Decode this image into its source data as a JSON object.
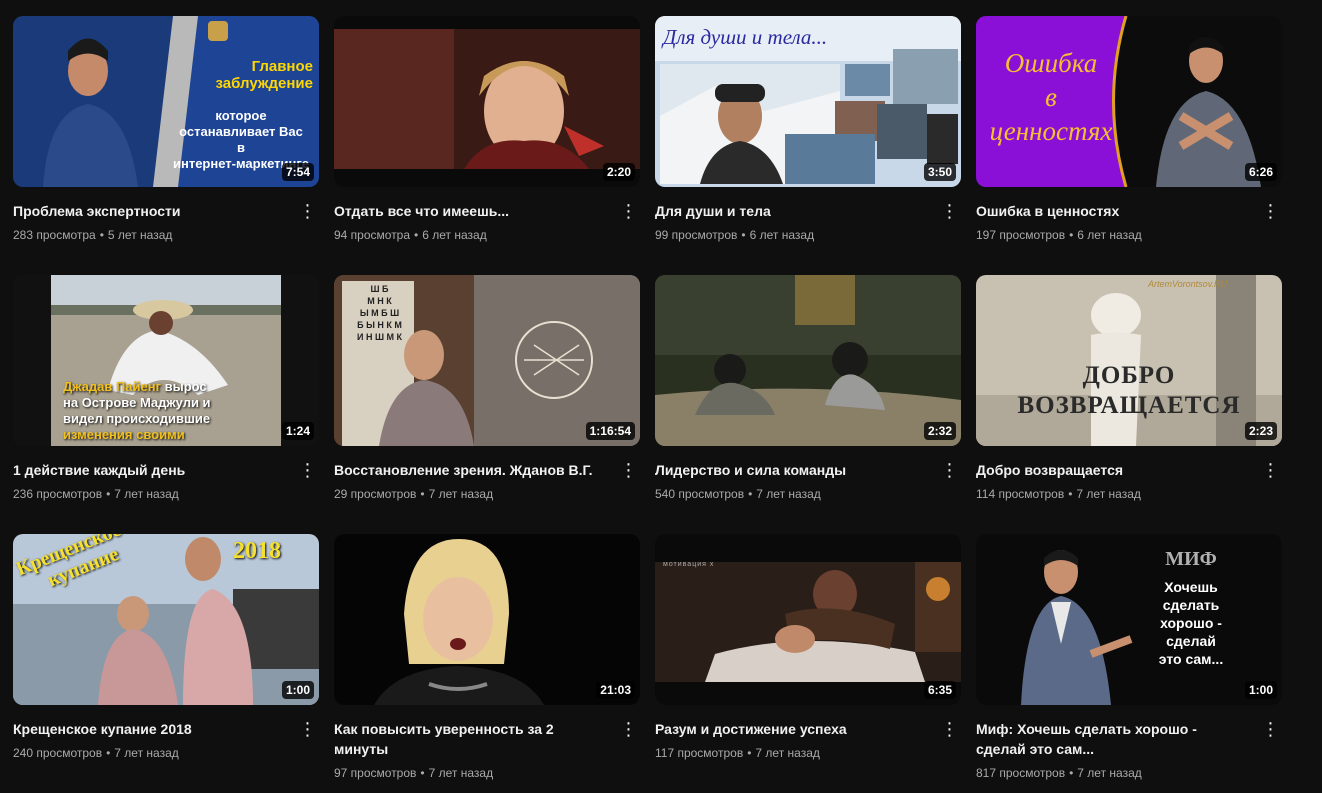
{
  "videos": [
    {
      "title": "Проблема экспертности",
      "views": "283 просмотра",
      "age": "5 лет назад",
      "duration": "7:54",
      "overlay": [
        "Главное",
        "заблуждение",
        "которое",
        "останавливает Вас",
        "в",
        "интернет-маркетинге"
      ]
    },
    {
      "title": "Отдать все что имеешь...",
      "views": "94 просмотра",
      "age": "6 лет назад",
      "duration": "2:20"
    },
    {
      "title": "Для души и тела",
      "views": "99 просмотров",
      "age": "6 лет назад",
      "duration": "3:50",
      "overlay": [
        "Для души и тела..."
      ]
    },
    {
      "title": "Ошибка в ценностях",
      "views": "197 просмотров",
      "age": "6 лет назад",
      "duration": "6:26",
      "overlay": [
        "Ошибка",
        "в",
        "ценностях"
      ]
    },
    {
      "title": "1 действие каждый день",
      "views": "236 просмотров",
      "age": "7 лет назад",
      "duration": "1:24",
      "overlay": [
        "Джадав Пайенг",
        " вырос",
        "на Острове Маджули и",
        "видел происходившие",
        "изменения своими"
      ]
    },
    {
      "title": "Восстановление зрения. Жданов В.Г.",
      "views": "29 просмотров",
      "age": "7 лет назад",
      "duration": "1:16:54",
      "overlay": [
        "Ш Б",
        "М Н К",
        "Ы М Б Ш",
        "Б Ы Н К М",
        "И Н Ш М К"
      ]
    },
    {
      "title": "Лидерство и сила команды",
      "views": "540 просмотров",
      "age": "7 лет назад",
      "duration": "2:32"
    },
    {
      "title": "Добро возвращается",
      "views": "114 просмотров",
      "age": "7 лет назад",
      "duration": "2:23",
      "overlay": [
        "ДОБРО",
        "ВОЗВРАЩАЕТСЯ",
        "ArtemVorontsov.RU"
      ]
    },
    {
      "title": "Крещенское купание 2018",
      "views": "240 просмотров",
      "age": "7 лет назад",
      "duration": "1:00",
      "overlay": [
        "Крещенское",
        "купание",
        "2018"
      ]
    },
    {
      "title": "Как повысить уверенность за 2 минуты",
      "views": "97 просмотров",
      "age": "7 лет назад",
      "duration": "21:03"
    },
    {
      "title": "Разум и достижение успеха",
      "views": "117 просмотров",
      "age": "7 лет назад",
      "duration": "6:35",
      "overlay": [
        "мотивация x"
      ]
    },
    {
      "title": "Миф: Хочешь сделать хорошо - сделай это сам...",
      "views": "817 просмотров",
      "age": "7 лет назад",
      "duration": "1:00",
      "overlay": [
        "МИФ",
        "Хочешь",
        "сделать",
        "хорошо -",
        "сделай",
        "это сам..."
      ]
    }
  ],
  "colors": {
    "background": "#0f0f0f",
    "title": "#f1f1f1",
    "meta": "#aaaaaa"
  },
  "icons": {
    "more": "vertical-ellipsis-icon"
  }
}
